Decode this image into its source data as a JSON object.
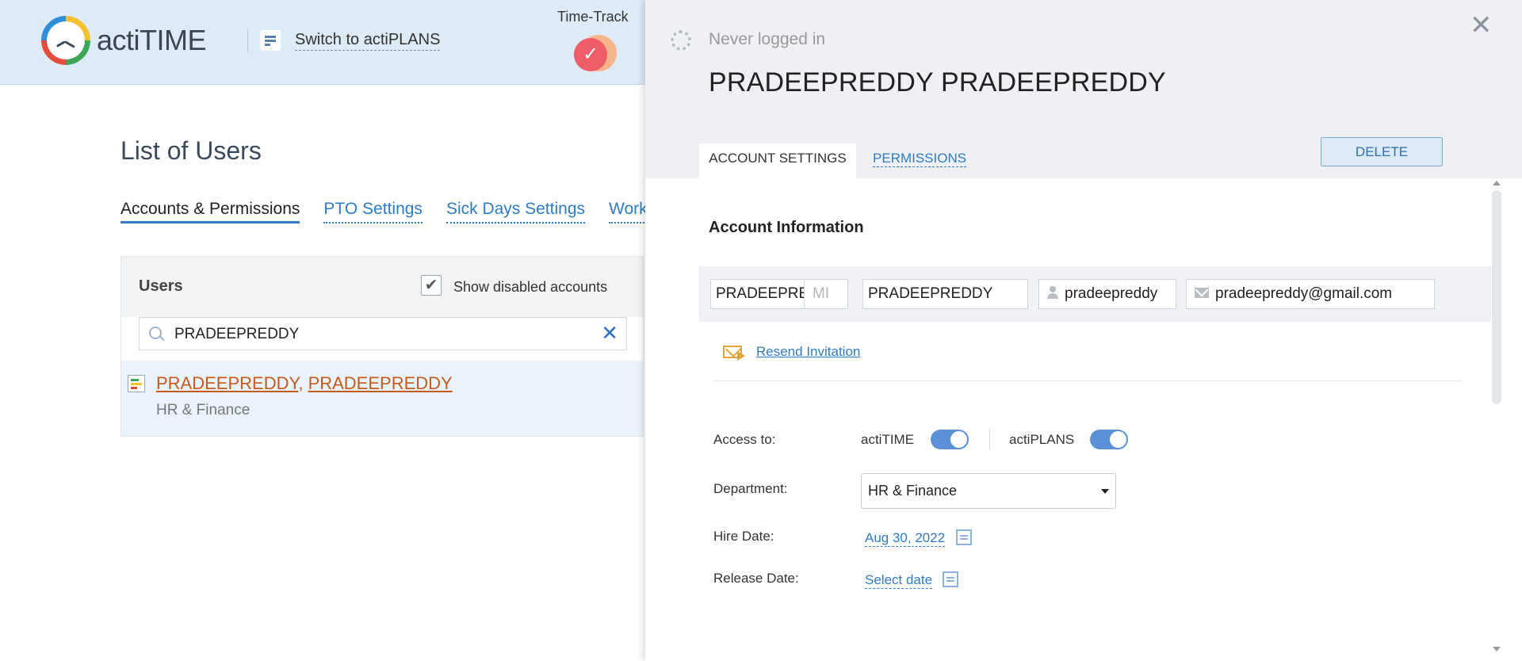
{
  "app": {
    "logo_text": "actiTIME"
  },
  "header": {
    "switch_label": "Switch to actiPLANS",
    "timetrack_label": "Time-Track"
  },
  "page": {
    "title": "List of Users",
    "subtabs": [
      "Accounts & Permissions",
      "PTO Settings",
      "Sick Days Settings",
      "Work"
    ]
  },
  "users": {
    "title": "Users",
    "show_disabled_label": "Show disabled accounts",
    "show_disabled_checked": true,
    "search_value": "PRADEEPREDDY",
    "rows": [
      {
        "last_name": "PRADEEPREDDY",
        "first_name": "PRADEEPREDDY",
        "separator": ", ",
        "department": "HR & Finance"
      }
    ]
  },
  "panel": {
    "status": "Never logged in",
    "full_name": "PRADEEPREDDY PRADEEPREDDY",
    "tabs": {
      "account": "ACCOUNT SETTINGS",
      "permissions": "PERMISSIONS"
    },
    "delete_label": "DELETE",
    "section_title": "Account Information",
    "fields": {
      "first_name": "PRADEEPREDDY",
      "middle_placeholder": "MI",
      "last_name": "PRADEEPREDDY",
      "username": "pradeepreddy",
      "email": "pradeepreddy@gmail.com"
    },
    "resend_label": "Resend Invitation",
    "access_label": "Access to:",
    "access": [
      {
        "name": "actiTIME",
        "enabled": true
      },
      {
        "name": "actiPLANS",
        "enabled": true
      }
    ],
    "department_label": "Department:",
    "department_value": "HR & Finance",
    "hire_date_label": "Hire Date:",
    "hire_date_value": "Aug 30, 2022",
    "release_date_label": "Release Date:",
    "release_date_value": "Select date"
  },
  "icons": [
    "actitime-logo-icon",
    "actiplans-icon",
    "timetrack-check-icon",
    "search-icon",
    "clear-icon",
    "user-list-icon",
    "spinner-icon",
    "close-icon",
    "person-icon",
    "mail-icon",
    "resend-mail-icon",
    "calendar-icon",
    "chevron-down-icon"
  ],
  "colors": {
    "accent": "#2f7bc7",
    "link_orange": "#c45a1b",
    "toggle_on": "#5b8fd6",
    "timetrack": "#ef5b66"
  }
}
